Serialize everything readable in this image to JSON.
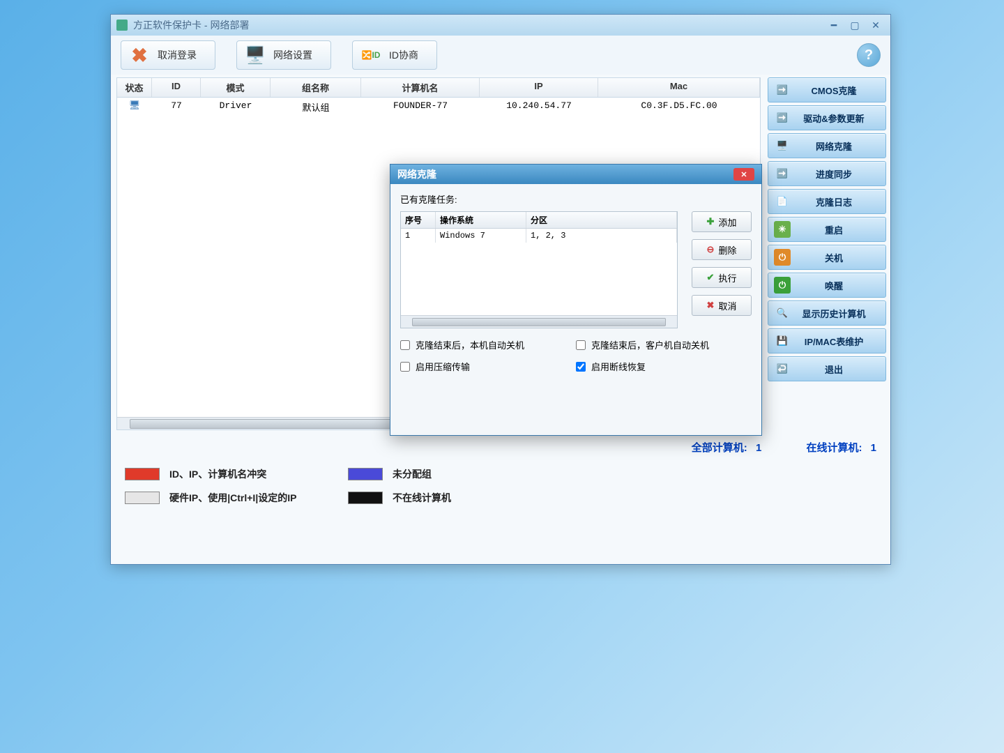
{
  "window": {
    "title": "方正软件保护卡 - 网络部署"
  },
  "toolbar": {
    "logout": "取消登录",
    "netset": "网络设置",
    "idneg": "ID协商",
    "help": "?"
  },
  "table": {
    "headers": {
      "status": "状态",
      "id": "ID",
      "mode": "模式",
      "group": "组名称",
      "host": "计算机名",
      "ip": "IP",
      "mac": "Mac"
    },
    "rows": [
      {
        "status": "",
        "id": "77",
        "mode": "Driver",
        "group": "默认组",
        "host": "FOUNDER-77",
        "ip": "10.240.54.77",
        "mac": "C0.3F.D5.FC.00"
      }
    ]
  },
  "sidebar": [
    "CMOS克隆",
    "驱动&参数更新",
    "网络克隆",
    "进度同步",
    "克隆日志",
    "重启",
    "关机",
    "唤醒",
    "显示历史计算机",
    "IP/MAC表维护",
    "退出"
  ],
  "status": {
    "total_label": "全部计算机:",
    "total_value": "1",
    "online_label": "在线计算机:",
    "online_value": "1"
  },
  "legend": {
    "conflict": "ID、IP、计算机名冲突",
    "unassigned": "未分配组",
    "hardip": "硬件IP、使用|Ctrl+I|设定的IP",
    "offline": "不在线计算机",
    "colors": {
      "conflict": "#e03a2a",
      "unassigned": "#4a4ad8",
      "hardip": "#e6e6e6",
      "offline": "#111111"
    }
  },
  "dialog": {
    "title": "网络克隆",
    "existing_label": "已有克隆任务:",
    "task_headers": {
      "seq": "序号",
      "os": "操作系统",
      "part": "分区"
    },
    "tasks": [
      {
        "seq": "1",
        "os": "Windows 7",
        "part": "1, 2, 3"
      }
    ],
    "buttons": {
      "add": "添加",
      "del": "删除",
      "run": "执行",
      "cancel": "取消"
    },
    "checks": {
      "auto_off_self": "克隆结束后，本机自动关机",
      "auto_off_client": "克隆结束后，客户机自动关机",
      "compress": "启用压缩传输",
      "resume": "启用断线恢复"
    },
    "checked": {
      "auto_off_self": false,
      "auto_off_client": false,
      "compress": false,
      "resume": true
    }
  }
}
